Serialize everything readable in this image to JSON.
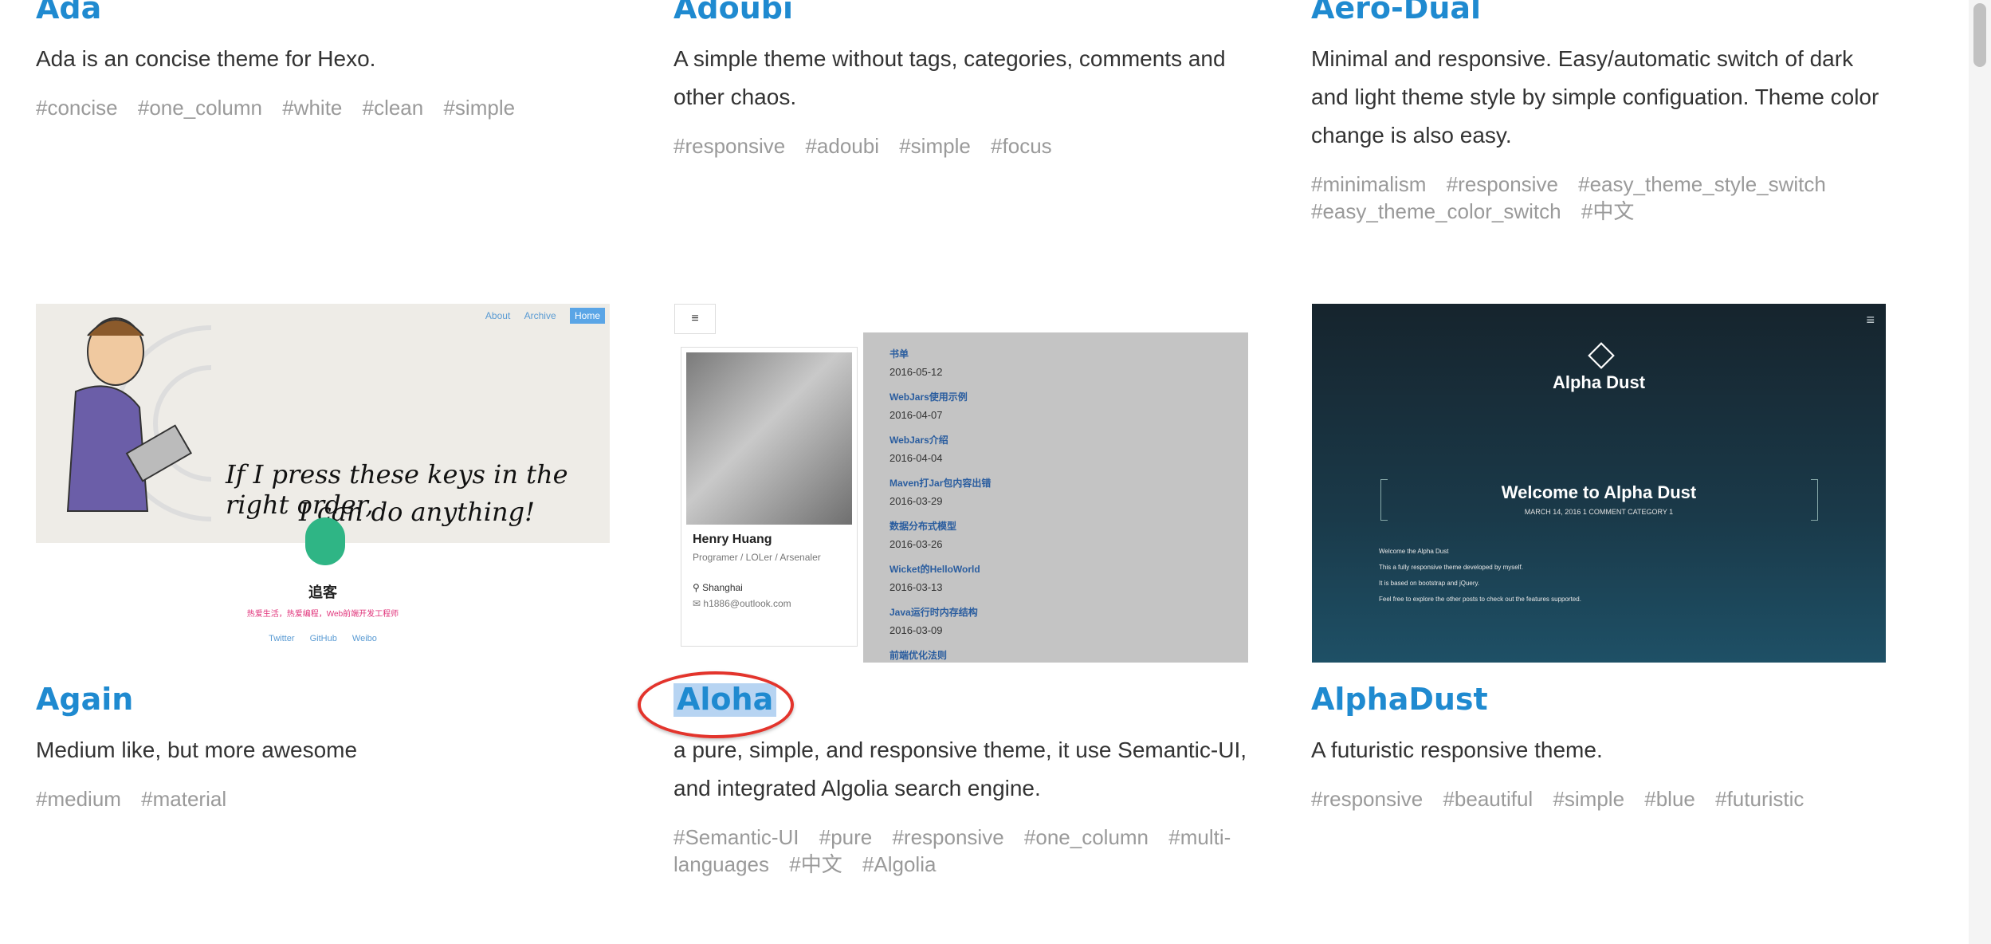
{
  "themes": [
    {
      "name": "Ada",
      "description": "Ada is an concise theme for Hexo.",
      "tags": [
        "#concise",
        "#one_column",
        "#white",
        "#clean",
        "#simple"
      ]
    },
    {
      "name": "Adoubi",
      "description": "A simple theme without tags, categories, comments and other chaos.",
      "tags": [
        "#responsive",
        "#adoubi",
        "#simple",
        "#focus"
      ]
    },
    {
      "name": "Aero-Dual",
      "description": "Minimal and responsive. Easy/automatic switch of dark and light theme style by simple configuation. Theme color change is also easy.",
      "tags": [
        "#minimalism",
        "#responsive",
        "#easy_theme_style_switch",
        "#easy_theme_color_switch",
        "#中文"
      ]
    },
    {
      "name": "Again",
      "description": "Medium like, but more awesome",
      "tags": [
        "#medium",
        "#material"
      ],
      "preview": {
        "nav": [
          "About",
          "Archive",
          "Home"
        ],
        "quote_line1": "If I press these keys in the right order,",
        "quote_line2": "I can do anything!",
        "site_name": "追客",
        "site_subtitle": "热爱生活，热爱编程，Web前端开发工程师",
        "links": [
          "Twitter",
          "GitHub",
          "Weibo"
        ]
      }
    },
    {
      "name": "Aloha",
      "description": "a pure, simple, and responsive theme, it use Semantic-UI, and integrated Algolia search engine.",
      "tags": [
        "#Semantic-UI",
        "#pure",
        "#responsive",
        "#one_column",
        "#multi-languages",
        "#中文",
        "#Algolia"
      ],
      "preview": {
        "menu_icon": "≡",
        "profile_name": "Henry Huang",
        "profile_role": "Programer / LOLer / Arsenaler",
        "location": "Shanghai",
        "email": "h1886@outlook.com",
        "posts": [
          {
            "title": "书单",
            "date": "2016-05-12"
          },
          {
            "title": "WebJars使用示例",
            "date": "2016-04-07"
          },
          {
            "title": "WebJars介绍",
            "date": "2016-04-04"
          },
          {
            "title": "Maven打Jar包内容出错",
            "date": "2016-03-29"
          },
          {
            "title": "数据分布式模型",
            "date": "2016-03-26"
          },
          {
            "title": "Wicket的HelloWorld",
            "date": "2016-03-13"
          },
          {
            "title": "Java运行时内存结构",
            "date": "2016-03-09"
          },
          {
            "title": "前端优化法则",
            "date": ""
          }
        ]
      }
    },
    {
      "name": "AlphaDust",
      "description": "A futuristic responsive theme.",
      "tags": [
        "#responsive",
        "#beautiful",
        "#simple",
        "#blue",
        "#futuristic"
      ],
      "preview": {
        "site_title": "Alpha Dust",
        "welcome": "Welcome to Alpha Dust",
        "meta": "MARCH 14, 2016   1 COMMENT   CATEGORY 1",
        "lines": [
          "Welcome the Alpha Dust",
          "This a fully responsive theme developed by myself.",
          "It is based on bootstrap and jQuery.",
          "Feel free to explore the other posts to check out the features supported."
        ]
      }
    }
  ],
  "colors": {
    "link": "#1f8ad0",
    "tag": "#9a9a9a",
    "annotation": "#e3342c"
  }
}
